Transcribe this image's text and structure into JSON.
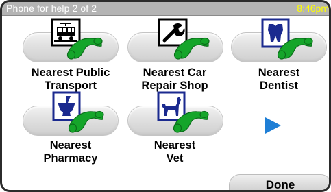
{
  "title": "Phone for help 2 of 2",
  "clock": "8:46pm",
  "items": [
    {
      "line1": "Nearest Public",
      "line2": "Transport",
      "icon": "tram-phone-icon"
    },
    {
      "line1": "Nearest Car",
      "line2": "Repair Shop",
      "icon": "wrench-phone-icon"
    },
    {
      "line1": "Nearest",
      "line2": "Dentist",
      "icon": "tooth-phone-icon"
    },
    {
      "line1": "Nearest",
      "line2": "Pharmacy",
      "icon": "mortar-pestle-phone-icon"
    },
    {
      "line1": "Nearest",
      "line2": "Vet",
      "icon": "dog-phone-icon"
    }
  ],
  "next_icon": "next-page-arrow-icon",
  "done_label": "Done",
  "colors": {
    "titlebar": "#b4b4b4",
    "clock": "#ffff00",
    "icon_blue": "#1b2a8f",
    "phone_green": "#15a52a",
    "arrow_blue": "#1f7fd6"
  }
}
